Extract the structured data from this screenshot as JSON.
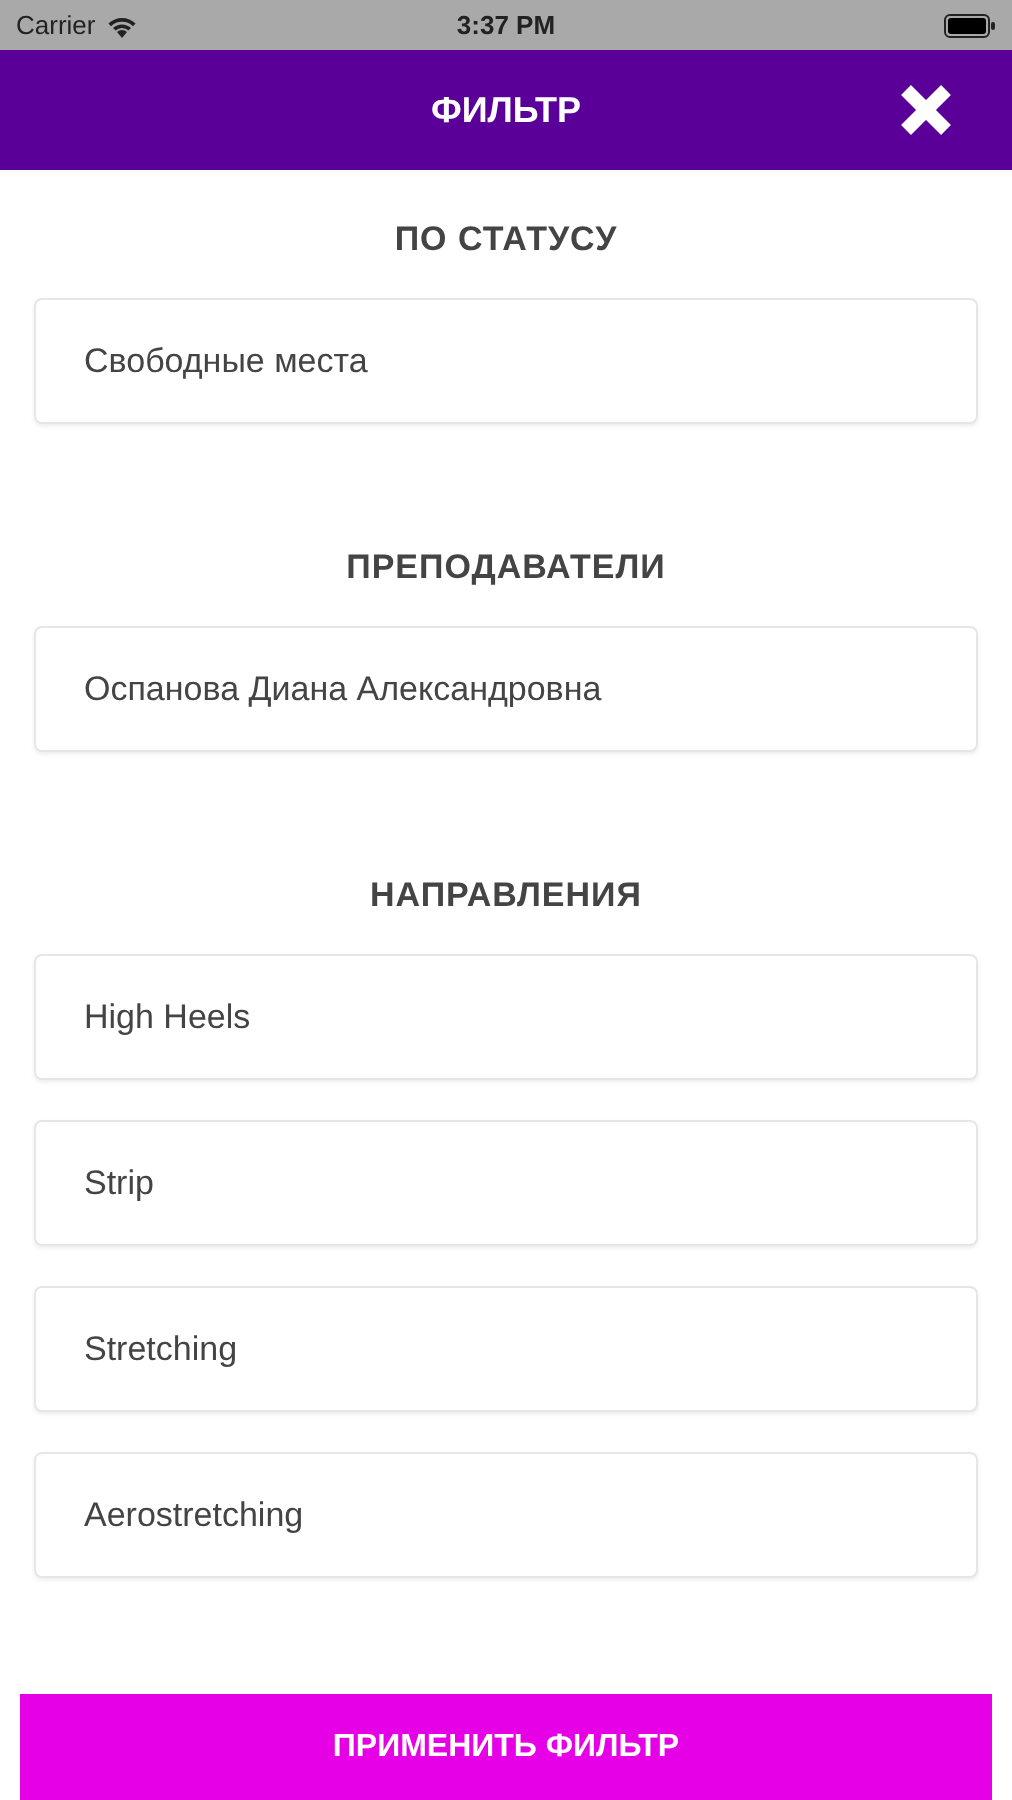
{
  "status_bar": {
    "carrier": "Carrier",
    "time": "3:37 PM"
  },
  "header": {
    "title": "ФИЛЬТР"
  },
  "sections": [
    {
      "title": "ПО СТАТУСУ",
      "options": [
        "Свободные места"
      ]
    },
    {
      "title": "ПРЕПОДАВАТЕЛИ",
      "options": [
        "Оспанова Диана Александровна"
      ]
    },
    {
      "title": "НАПРАВЛЕНИЯ",
      "options": [
        "High Heels",
        "Strip",
        "Stretching",
        "Aerostretching"
      ]
    }
  ],
  "apply_button": "ПРИМЕНИТЬ ФИЛЬТР"
}
